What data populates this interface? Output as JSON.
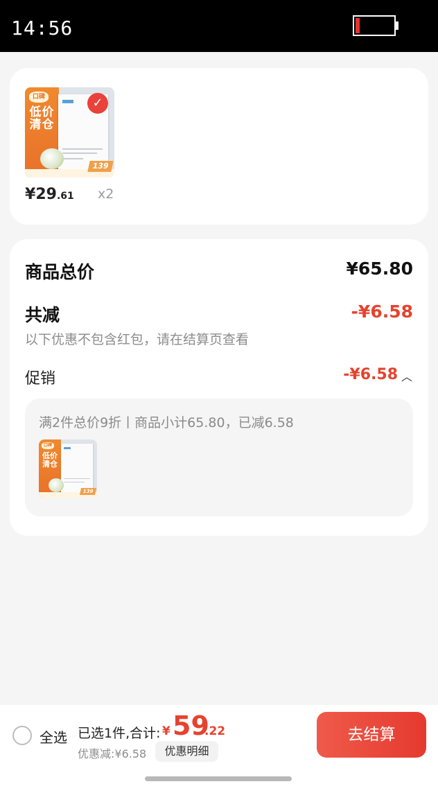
{
  "status_bar": {
    "time": "14:56",
    "battery_level": 0.12,
    "battery_color": "#e8332b"
  },
  "product": {
    "thumbnail": {
      "logo": "口碑",
      "band_text": "低价清仓",
      "corner_price": "139"
    },
    "price": {
      "yen": "¥",
      "integer": "29",
      "decimal": ".61"
    },
    "quantity": "x2"
  },
  "summary": {
    "total_label": "商品总价",
    "total_value": "¥65.80",
    "reduction_label": "共减",
    "reduction_value": "-¥6.58",
    "note": "以下优惠不包含红包，请在结算页查看",
    "promo_label": "促销",
    "promo_value": "-¥6.58",
    "promo_caret_icon": "chevron-up-icon",
    "promo_desc": "满2件总价9折丨商品小计65.80，已减6.58"
  },
  "bottom_bar": {
    "select_all": "全选",
    "selected_info": "已选1件,合计:",
    "total_yen": "¥",
    "total_integer": "59",
    "total_decimal": ".22",
    "discount_note": "优惠减:¥6.58",
    "detail_button": "优惠明细",
    "checkout_button": "去结算"
  },
  "colors": {
    "accent": "#e5432e",
    "background": "#f5f5f5"
  }
}
